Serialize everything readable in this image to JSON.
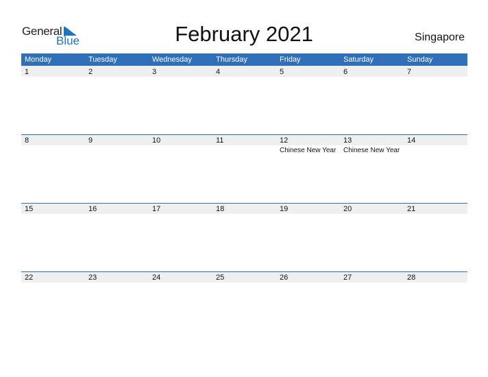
{
  "logo": {
    "general": "General",
    "blue": "Blue"
  },
  "title": "February 2021",
  "country": "Singapore",
  "colors": {
    "header": "#2e6fb7",
    "band": "#efefef",
    "logo_blue": "#1d73c4"
  },
  "weekdays": [
    "Monday",
    "Tuesday",
    "Wednesday",
    "Thursday",
    "Friday",
    "Saturday",
    "Sunday"
  ],
  "weeks": [
    {
      "days": [
        {
          "day": "1",
          "event": ""
        },
        {
          "day": "2",
          "event": ""
        },
        {
          "day": "3",
          "event": ""
        },
        {
          "day": "4",
          "event": ""
        },
        {
          "day": "5",
          "event": ""
        },
        {
          "day": "6",
          "event": ""
        },
        {
          "day": "7",
          "event": ""
        }
      ]
    },
    {
      "days": [
        {
          "day": "8",
          "event": ""
        },
        {
          "day": "9",
          "event": ""
        },
        {
          "day": "10",
          "event": ""
        },
        {
          "day": "11",
          "event": ""
        },
        {
          "day": "12",
          "event": "Chinese New Year"
        },
        {
          "day": "13",
          "event": "Chinese New Year"
        },
        {
          "day": "14",
          "event": ""
        }
      ]
    },
    {
      "days": [
        {
          "day": "15",
          "event": ""
        },
        {
          "day": "16",
          "event": ""
        },
        {
          "day": "17",
          "event": ""
        },
        {
          "day": "18",
          "event": ""
        },
        {
          "day": "19",
          "event": ""
        },
        {
          "day": "20",
          "event": ""
        },
        {
          "day": "21",
          "event": ""
        }
      ]
    },
    {
      "days": [
        {
          "day": "22",
          "event": ""
        },
        {
          "day": "23",
          "event": ""
        },
        {
          "day": "24",
          "event": ""
        },
        {
          "day": "25",
          "event": ""
        },
        {
          "day": "26",
          "event": ""
        },
        {
          "day": "27",
          "event": ""
        },
        {
          "day": "28",
          "event": ""
        }
      ]
    }
  ]
}
